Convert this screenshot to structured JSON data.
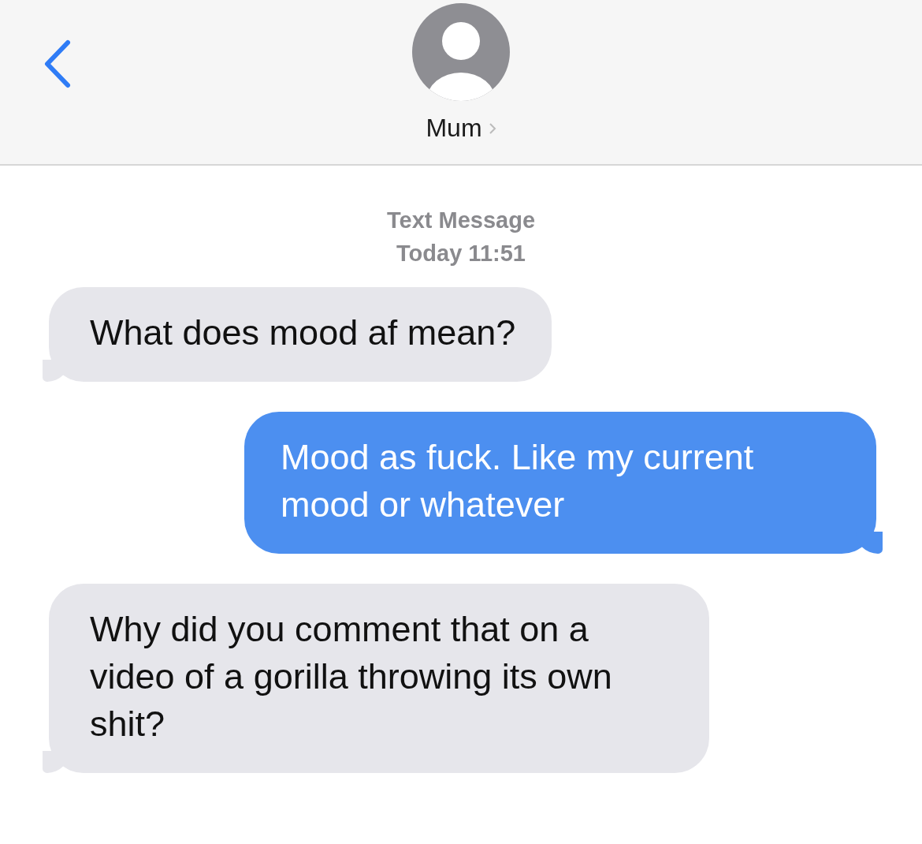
{
  "header": {
    "contact": "Mum"
  },
  "meta": {
    "label": "Text Message",
    "time": "Today 11:51"
  },
  "messages": [
    {
      "kind": "received",
      "text": "What does mood af mean?"
    },
    {
      "kind": "sent",
      "text": "Mood as fuck. Like my current mood or whatever"
    },
    {
      "kind": "received",
      "text": "Why did you comment that on a video of a gorilla throwing its own shit?"
    }
  ]
}
